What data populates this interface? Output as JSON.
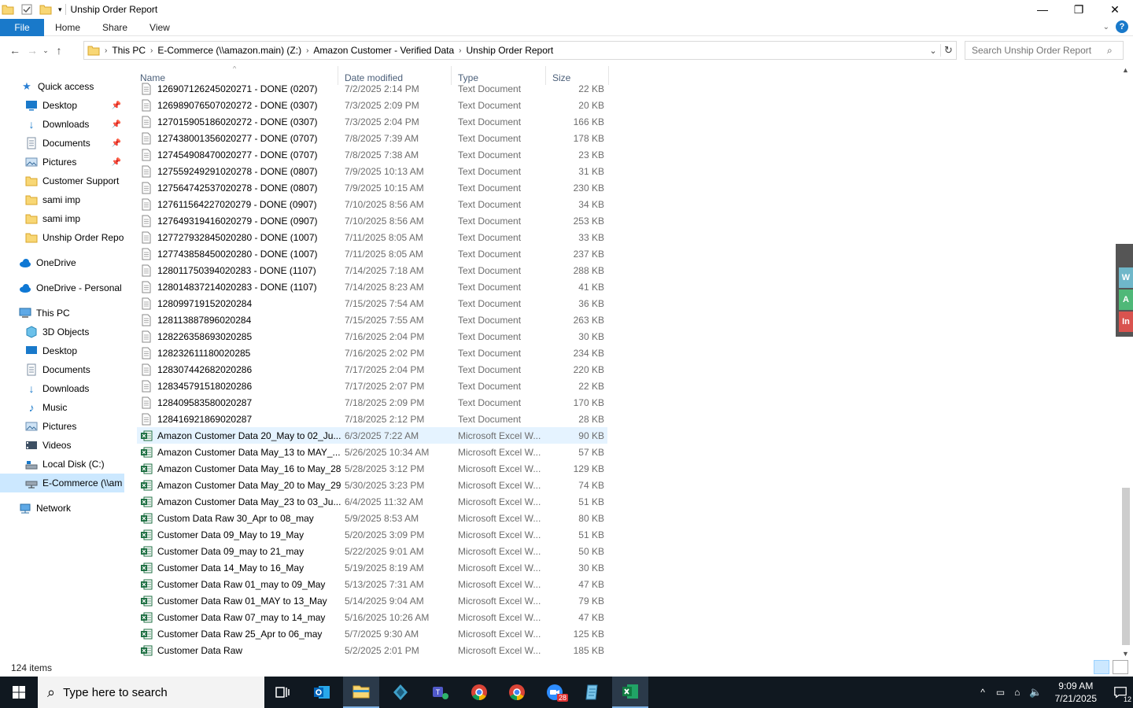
{
  "window": {
    "title": "Unship Order Report",
    "controls": {
      "minimize": "—",
      "maximize": "❐",
      "close": "✕"
    }
  },
  "ribbon": {
    "file": "File",
    "tabs": [
      "Home",
      "Share",
      "View"
    ]
  },
  "address": {
    "crumbs": [
      "This PC",
      "E-Commerce (\\\\amazon.main) (Z:)",
      "Amazon Customer - Verified Data",
      "Unship Order Report"
    ]
  },
  "search": {
    "placeholder": "Search Unship Order Report"
  },
  "nav": {
    "quick_access": "Quick access",
    "pinned": [
      "Desktop",
      "Downloads",
      "Documents",
      "Pictures"
    ],
    "folders": [
      "Customer Support",
      "sami imp",
      "sami imp",
      "Unship Order Repor"
    ],
    "onedrive": "OneDrive",
    "onedrive_personal": "OneDrive - Personal",
    "this_pc": "This PC",
    "pc_items": [
      "3D Objects",
      "Desktop",
      "Documents",
      "Downloads",
      "Music",
      "Pictures",
      "Videos",
      "Local Disk (C:)",
      "E-Commerce (\\\\am"
    ],
    "network": "Network"
  },
  "columns": {
    "name": "Name",
    "date": "Date modified",
    "type": "Type",
    "size": "Size"
  },
  "files": [
    {
      "name": "126907126245020271 - DONE (0207)",
      "date": "7/2/2025 2:14 PM",
      "type": "Text Document",
      "size": "22 KB",
      "kind": "txt"
    },
    {
      "name": "126989076507020272 - DONE (0307)",
      "date": "7/3/2025 2:09 PM",
      "type": "Text Document",
      "size": "20 KB",
      "kind": "txt"
    },
    {
      "name": "127015905186020272 - DONE (0307)",
      "date": "7/3/2025 2:04 PM",
      "type": "Text Document",
      "size": "166 KB",
      "kind": "txt"
    },
    {
      "name": "127438001356020277 - DONE (0707)",
      "date": "7/8/2025 7:39 AM",
      "type": "Text Document",
      "size": "178 KB",
      "kind": "txt"
    },
    {
      "name": "127454908470020277 - DONE (0707)",
      "date": "7/8/2025 7:38 AM",
      "type": "Text Document",
      "size": "23 KB",
      "kind": "txt"
    },
    {
      "name": "127559249291020278 - DONE (0807)",
      "date": "7/9/2025 10:13 AM",
      "type": "Text Document",
      "size": "31 KB",
      "kind": "txt"
    },
    {
      "name": "127564742537020278 - DONE (0807)",
      "date": "7/9/2025 10:15 AM",
      "type": "Text Document",
      "size": "230 KB",
      "kind": "txt"
    },
    {
      "name": "127611564227020279 - DONE (0907)",
      "date": "7/10/2025 8:56 AM",
      "type": "Text Document",
      "size": "34 KB",
      "kind": "txt"
    },
    {
      "name": "127649319416020279 - DONE (0907)",
      "date": "7/10/2025 8:56 AM",
      "type": "Text Document",
      "size": "253 KB",
      "kind": "txt"
    },
    {
      "name": "127727932845020280 - DONE (1007)",
      "date": "7/11/2025 8:05 AM",
      "type": "Text Document",
      "size": "33 KB",
      "kind": "txt"
    },
    {
      "name": "127743858450020280 - DONE (1007)",
      "date": "7/11/2025 8:05 AM",
      "type": "Text Document",
      "size": "237 KB",
      "kind": "txt"
    },
    {
      "name": "128011750394020283 - DONE (1107)",
      "date": "7/14/2025 7:18 AM",
      "type": "Text Document",
      "size": "288 KB",
      "kind": "txt"
    },
    {
      "name": "128014837214020283 - DONE (1107)",
      "date": "7/14/2025 8:23 AM",
      "type": "Text Document",
      "size": "41 KB",
      "kind": "txt"
    },
    {
      "name": "128099719152020284",
      "date": "7/15/2025 7:54 AM",
      "type": "Text Document",
      "size": "36 KB",
      "kind": "txt"
    },
    {
      "name": "128113887896020284",
      "date": "7/15/2025 7:55 AM",
      "type": "Text Document",
      "size": "263 KB",
      "kind": "txt"
    },
    {
      "name": "128226358693020285",
      "date": "7/16/2025 2:04 PM",
      "type": "Text Document",
      "size": "30 KB",
      "kind": "txt"
    },
    {
      "name": "128232611180020285",
      "date": "7/16/2025 2:02 PM",
      "type": "Text Document",
      "size": "234 KB",
      "kind": "txt"
    },
    {
      "name": "128307442682020286",
      "date": "7/17/2025 2:04 PM",
      "type": "Text Document",
      "size": "220 KB",
      "kind": "txt"
    },
    {
      "name": "128345791518020286",
      "date": "7/17/2025 2:07 PM",
      "type": "Text Document",
      "size": "22 KB",
      "kind": "txt"
    },
    {
      "name": "128409583580020287",
      "date": "7/18/2025 2:09 PM",
      "type": "Text Document",
      "size": "170 KB",
      "kind": "txt"
    },
    {
      "name": "128416921869020287",
      "date": "7/18/2025 2:12 PM",
      "type": "Text Document",
      "size": "28 KB",
      "kind": "txt"
    },
    {
      "name": "Amazon Customer Data 20_May to 02_Ju...",
      "date": "6/3/2025 7:22 AM",
      "type": "Microsoft Excel W...",
      "size": "90 KB",
      "kind": "xls",
      "selected": true
    },
    {
      "name": "Amazon Customer Data May_13 to MAY_...",
      "date": "5/26/2025 10:34 AM",
      "type": "Microsoft Excel W...",
      "size": "57 KB",
      "kind": "xls"
    },
    {
      "name": "Amazon Customer Data May_16 to May_28",
      "date": "5/28/2025 3:12 PM",
      "type": "Microsoft Excel W...",
      "size": "129 KB",
      "kind": "xls"
    },
    {
      "name": "Amazon Customer Data May_20 to May_29",
      "date": "5/30/2025 3:23 PM",
      "type": "Microsoft Excel W...",
      "size": "74 KB",
      "kind": "xls"
    },
    {
      "name": "Amazon Customer Data May_23 to 03_Ju...",
      "date": "6/4/2025 11:32 AM",
      "type": "Microsoft Excel W...",
      "size": "51 KB",
      "kind": "xls"
    },
    {
      "name": "Custom Data Raw 30_Apr to 08_may",
      "date": "5/9/2025 8:53 AM",
      "type": "Microsoft Excel W...",
      "size": "80 KB",
      "kind": "xls"
    },
    {
      "name": "Customer Data 09_May to 19_May",
      "date": "5/20/2025 3:09 PM",
      "type": "Microsoft Excel W...",
      "size": "51 KB",
      "kind": "xls"
    },
    {
      "name": "Customer Data 09_may to 21_may",
      "date": "5/22/2025 9:01 AM",
      "type": "Microsoft Excel W...",
      "size": "50 KB",
      "kind": "xls"
    },
    {
      "name": "Customer Data 14_May to 16_May",
      "date": "5/19/2025 8:19 AM",
      "type": "Microsoft Excel W...",
      "size": "30 KB",
      "kind": "xls"
    },
    {
      "name": "Customer Data Raw 01_may to 09_May",
      "date": "5/13/2025 7:31 AM",
      "type": "Microsoft Excel W...",
      "size": "47 KB",
      "kind": "xls"
    },
    {
      "name": "Customer Data Raw 01_MAY to 13_May",
      "date": "5/14/2025 9:04 AM",
      "type": "Microsoft Excel W...",
      "size": "79 KB",
      "kind": "xls"
    },
    {
      "name": "Customer Data Raw 07_may to 14_may",
      "date": "5/16/2025 10:26 AM",
      "type": "Microsoft Excel W...",
      "size": "47 KB",
      "kind": "xls"
    },
    {
      "name": "Customer Data Raw 25_Apr to 06_may",
      "date": "5/7/2025 9:30 AM",
      "type": "Microsoft Excel W...",
      "size": "125 KB",
      "kind": "xls"
    },
    {
      "name": "Customer Data Raw",
      "date": "5/2/2025 2:01 PM",
      "type": "Microsoft Excel W...",
      "size": "185 KB",
      "kind": "xls"
    }
  ],
  "status": {
    "items": "124 items"
  },
  "side_widget": {
    "labels": [
      "W",
      "A",
      "In"
    ],
    "colors": [
      "#6fb7c9",
      "#4fb878",
      "#d9534f"
    ]
  },
  "taskbar": {
    "search_placeholder": "Type here to search",
    "zoom_badge": "28",
    "time": "9:09 AM",
    "date": "7/21/2025",
    "notif_count": "12"
  },
  "colors": {
    "accent": "#1979ca",
    "excel": "#1d6f42",
    "folder": "#f8d775",
    "taskbar": "#101820"
  }
}
